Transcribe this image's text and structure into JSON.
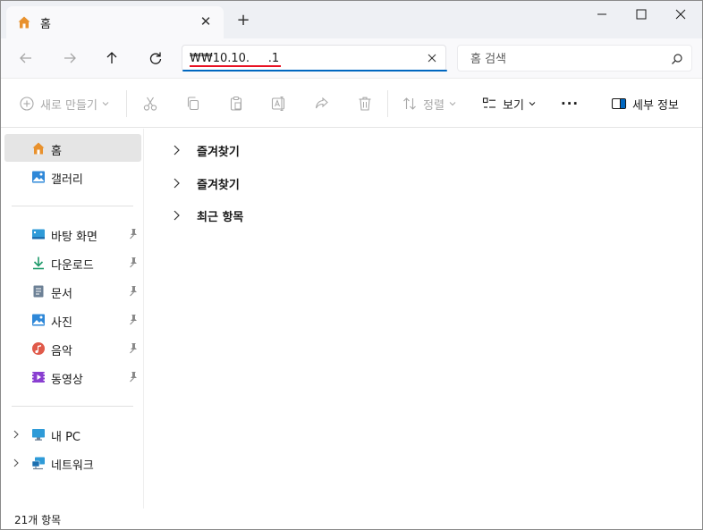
{
  "tab": {
    "title": "홈",
    "icon": "home-icon",
    "close_label": "✕"
  },
  "new_tab_label": "+",
  "address": {
    "value": "₩₩10.10.     .1"
  },
  "search": {
    "placeholder": "홈 검색",
    "icon": "search-icon"
  },
  "toolbar": {
    "new_label": "새로 만들기",
    "sort_label": "정렬",
    "view_label": "보기",
    "more_label": "···",
    "details_label": "세부 정보"
  },
  "sidebar": {
    "top_items": [
      {
        "label": "홈",
        "icon": "home-icon",
        "selected": true
      },
      {
        "label": "갤러리",
        "icon": "gallery-icon",
        "selected": false
      }
    ],
    "pinned_items": [
      {
        "label": "바탕 화면",
        "icon": "desktop-icon",
        "pinned": true
      },
      {
        "label": "다운로드",
        "icon": "download-icon",
        "pinned": true
      },
      {
        "label": "문서",
        "icon": "documents-icon",
        "pinned": true
      },
      {
        "label": "사진",
        "icon": "pictures-icon",
        "pinned": true
      },
      {
        "label": "음악",
        "icon": "music-icon",
        "pinned": true
      },
      {
        "label": "동영상",
        "icon": "videos-icon",
        "pinned": true
      }
    ],
    "bottom_items": [
      {
        "label": "내 PC",
        "icon": "this-pc-icon"
      },
      {
        "label": "네트워크",
        "icon": "network-icon"
      }
    ]
  },
  "main": {
    "groups": [
      {
        "label": "즐겨찾기"
      },
      {
        "label": "즐겨찾기"
      },
      {
        "label": "최근 항목"
      }
    ]
  },
  "status": {
    "item_count": "21개 항목"
  },
  "colors": {
    "accent": "#0067c0",
    "selection": "#e5e5e5",
    "home_orange": "#e8912d",
    "error_red": "#e81123"
  }
}
